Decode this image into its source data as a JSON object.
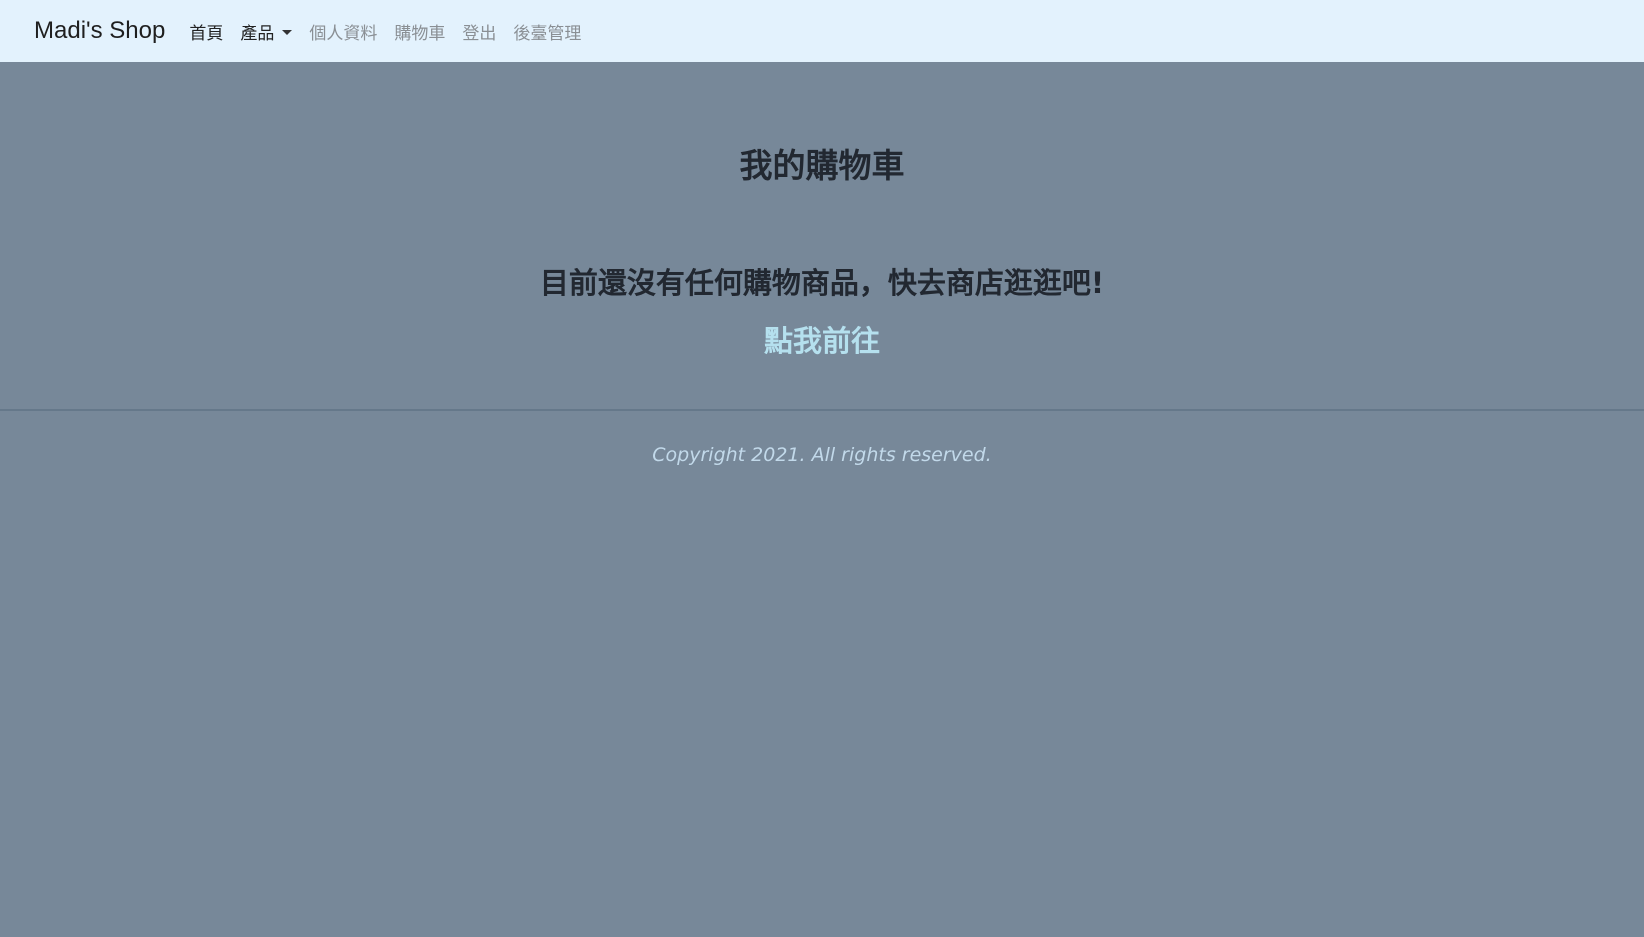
{
  "navbar": {
    "brand": "Madi's Shop",
    "items": [
      {
        "label": "首頁"
      },
      {
        "label": "產品"
      },
      {
        "label": "個人資料"
      },
      {
        "label": "購物車"
      },
      {
        "label": "登出"
      },
      {
        "label": "後臺管理"
      }
    ]
  },
  "main": {
    "title": "我的購物車",
    "empty_message": "目前還沒有任何購物商品，快去商店逛逛吧!",
    "link_label": "點我前往"
  },
  "footer": {
    "copyright": "Copyright 2021. All rights reserved."
  },
  "colors": {
    "navbar_bg": "#e3f2fd",
    "page_bg": "#778899",
    "link": "#b5e0ee"
  }
}
